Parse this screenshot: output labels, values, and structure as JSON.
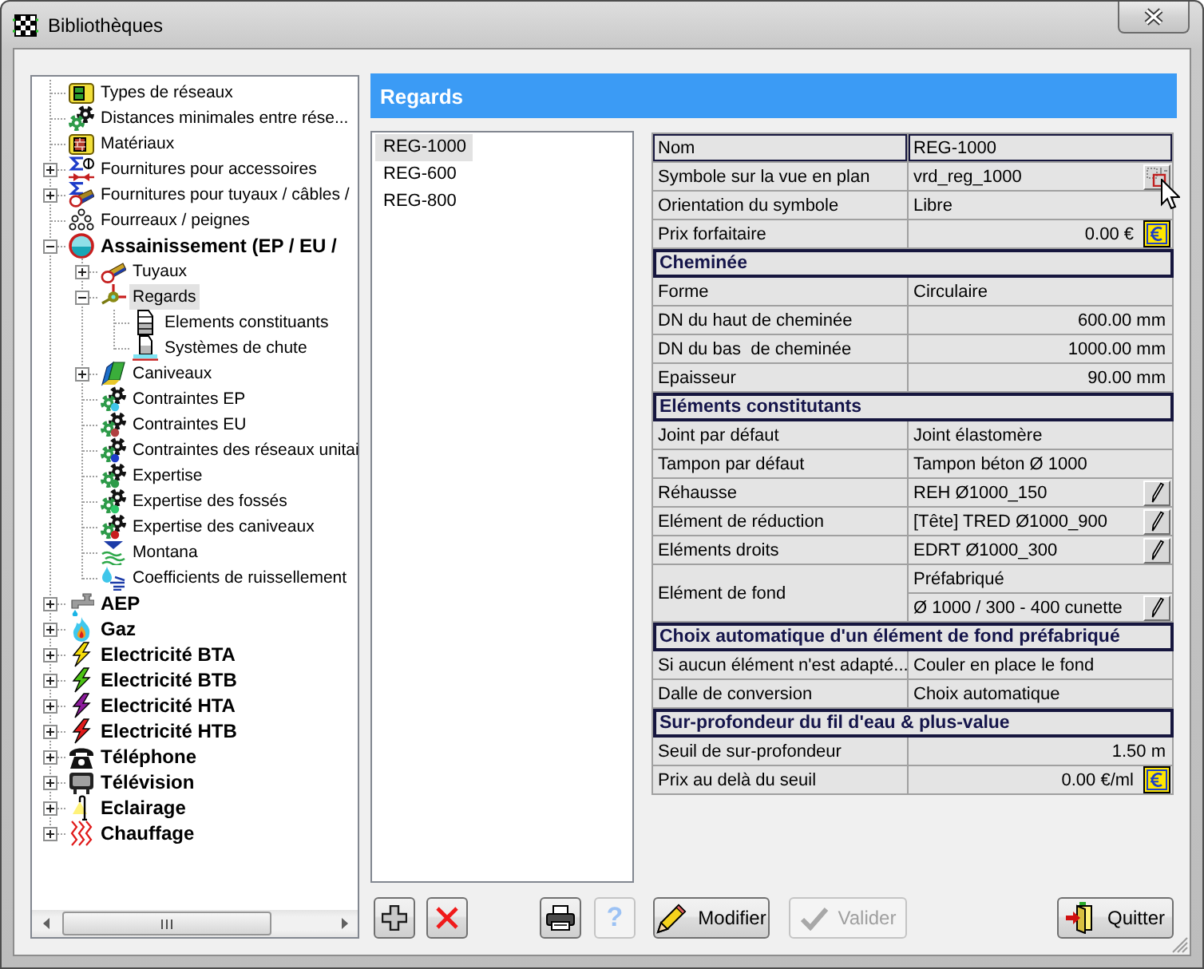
{
  "window": {
    "title": "Bibliothèques"
  },
  "tree": [
    {
      "label": "Types de réseaux",
      "kind": "item",
      "selected": false
    },
    {
      "label": "Distances minimales entre rése...",
      "kind": "item",
      "selected": false
    },
    {
      "label": "Matériaux",
      "kind": "item",
      "selected": false
    },
    {
      "label": "Fournitures pour accessoires",
      "kind": "item",
      "selected": false,
      "expanded": false
    },
    {
      "label": "Fournitures pour tuyaux / câbles /",
      "kind": "item",
      "selected": false,
      "expanded": false
    },
    {
      "label": "Fourreaux / peignes",
      "kind": "item",
      "selected": false
    },
    {
      "label": "Assainissement (EP / EU /",
      "kind": "network",
      "selected": false,
      "expanded": true,
      "children": [
        {
          "label": "Tuyaux",
          "kind": "item",
          "selected": false,
          "expanded": false
        },
        {
          "label": "Regards",
          "kind": "item",
          "selected": true,
          "expanded": true,
          "children": [
            {
              "label": "Elements constituants",
              "kind": "item",
              "selected": false
            },
            {
              "label": "Systèmes de chute",
              "kind": "item",
              "selected": false
            }
          ]
        },
        {
          "label": "Caniveaux",
          "kind": "item",
          "selected": false,
          "expanded": false
        },
        {
          "label": "Contraintes EP",
          "kind": "item",
          "selected": false
        },
        {
          "label": "Contraintes EU",
          "kind": "item",
          "selected": false
        },
        {
          "label": "Contraintes des réseaux unitai",
          "kind": "item",
          "selected": false
        },
        {
          "label": "Expertise",
          "kind": "item",
          "selected": false
        },
        {
          "label": "Expertise des fossés",
          "kind": "item",
          "selected": false
        },
        {
          "label": "Expertise des caniveaux",
          "kind": "item",
          "selected": false
        },
        {
          "label": "Montana",
          "kind": "item",
          "selected": false
        },
        {
          "label": "Coefficients de ruissellement",
          "kind": "item",
          "selected": false
        }
      ]
    },
    {
      "label": "AEP",
      "kind": "network",
      "selected": false,
      "expanded": false
    },
    {
      "label": "Gaz",
      "kind": "network",
      "selected": false,
      "expanded": false
    },
    {
      "label": "Electricité BTA",
      "kind": "network",
      "selected": false,
      "expanded": false
    },
    {
      "label": "Electricité BTB",
      "kind": "network",
      "selected": false,
      "expanded": false
    },
    {
      "label": "Electricité HTA",
      "kind": "network",
      "selected": false,
      "expanded": false
    },
    {
      "label": "Electricité HTB",
      "kind": "network",
      "selected": false,
      "expanded": false
    },
    {
      "label": "Téléphone",
      "kind": "network",
      "selected": false,
      "expanded": false
    },
    {
      "label": "Télévision",
      "kind": "network",
      "selected": false,
      "expanded": false
    },
    {
      "label": "Eclairage",
      "kind": "network",
      "selected": false,
      "expanded": false
    },
    {
      "label": "Chauffage",
      "kind": "network",
      "selected": false,
      "expanded": false
    }
  ],
  "panel": {
    "title": "Regards"
  },
  "list": [
    {
      "label": "REG-1000",
      "selected": true
    },
    {
      "label": "REG-600",
      "selected": false
    },
    {
      "label": "REG-800",
      "selected": false
    }
  ],
  "properties": [
    {
      "rows": [
        {
          "label": "Nom",
          "kind": "text",
          "value": "REG-1000",
          "selected": true
        },
        {
          "label": "Symbole sur la vue en plan",
          "kind": "symbol",
          "value": "vrd_reg_1000",
          "selected": false,
          "hovered": true
        },
        {
          "label": "Orientation du symbole",
          "kind": "text",
          "value": "Libre",
          "selected": false
        },
        {
          "label": "Prix forfaitaire",
          "kind": "price",
          "value": "0.00 €",
          "selected": false
        }
      ]
    },
    {
      "title": "Cheminée",
      "rows": [
        {
          "label": "Forme",
          "kind": "text",
          "value": "Circulaire",
          "selected": false
        },
        {
          "label": "DN du haut de cheminée",
          "kind": "number",
          "value": "600.00 mm",
          "selected": false
        },
        {
          "label": "DN du bas  de cheminée",
          "kind": "number",
          "value": "1000.00 mm",
          "selected": false
        },
        {
          "label": "Epaisseur",
          "kind": "number",
          "value": "90.00 mm",
          "selected": false
        }
      ]
    },
    {
      "title": "Eléments constitutants",
      "rows": [
        {
          "label": "Joint par défaut",
          "kind": "text",
          "value": "Joint élastomère",
          "selected": false
        },
        {
          "label": "Tampon par défaut",
          "kind": "text",
          "value": "Tampon béton Ø 1000",
          "selected": false
        },
        {
          "label": "Réhausse",
          "kind": "reference",
          "value": "REH Ø1000_150",
          "selected": false
        },
        {
          "label": "Elément de réduction",
          "kind": "reference",
          "value": "[Tête] TRED Ø1000_900",
          "selected": false
        },
        {
          "label": "Eléments droits",
          "kind": "reference",
          "value": "EDRT Ø1000_300",
          "selected": false
        },
        {
          "label": "Elément de fond",
          "kind": "stacked",
          "values": [
            "Préfabriqué",
            "Ø 1000 / 300 - 400 cunette"
          ],
          "selected": false
        }
      ]
    },
    {
      "title": "Choix automatique d'un élément de fond préfabriqué",
      "rows": [
        {
          "label": "Si aucun élément n'est adapté...",
          "kind": "text",
          "value": "Couler en place le fond",
          "selected": false
        },
        {
          "label": "Dalle de conversion",
          "kind": "text",
          "value": "Choix automatique",
          "selected": false
        }
      ]
    },
    {
      "title": "Sur-profondeur du fil d'eau & plus-value",
      "rows": [
        {
          "label": "Seuil de sur-profondeur",
          "kind": "number",
          "value": "1.50 m",
          "selected": false
        },
        {
          "label": "Prix au delà du seuil",
          "kind": "price",
          "value": "0.00 €/ml",
          "selected": false
        }
      ]
    }
  ],
  "buttons": [
    {
      "kind": "add",
      "disabled": false
    },
    {
      "kind": "delete",
      "disabled": false
    },
    {
      "kind": "print",
      "disabled": false
    },
    {
      "kind": "help",
      "label": "?",
      "disabled": true
    },
    {
      "kind": "edit",
      "label": "Modifier",
      "disabled": false
    },
    {
      "kind": "confirm",
      "label": "Valider",
      "disabled": true
    },
    {
      "kind": "quit",
      "label": "Quitter",
      "disabled": false
    }
  ]
}
